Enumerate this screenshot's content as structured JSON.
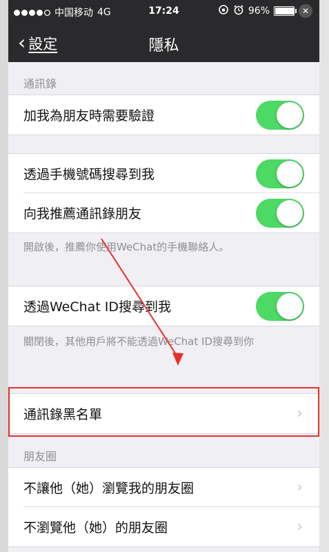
{
  "status_bar": {
    "carrier": "中国移动",
    "network": "4G",
    "time": "17:24",
    "battery_percent": "96%",
    "battery_level": 0.96
  },
  "nav": {
    "back_label": "設定",
    "title": "隱私"
  },
  "sections": {
    "contacts": {
      "header": "通訊錄",
      "verify_label": "加我為朋友時需要驗證"
    },
    "phone_search": {
      "search_by_phone_label": "透過手機號碼搜尋到我",
      "recommend_contacts_label": "向我推薦通訊錄朋友",
      "note": "開啟後，推薦你使用WeChat的手機聯絡人。"
    },
    "wechat_id": {
      "search_by_id_label": "透過WeChat ID搜尋到我",
      "note": "關閉後，其他用戶將不能透過WeChat ID搜尋到你"
    },
    "blacklist": {
      "label": "通訊錄黑名單"
    },
    "moments": {
      "header": "朋友圈",
      "hide_my_moments_label": "不讓他（她）瀏覽我的朋友圈",
      "hide_their_moments_label": "不瀏覽他（她）的朋友圈"
    }
  },
  "toggles": {
    "verify": true,
    "search_by_phone": true,
    "recommend_contacts": true,
    "search_by_id": true
  },
  "colors": {
    "toggle_on": "#4cd964",
    "nav_background": "#2a2a2c",
    "annotation_red": "#e8302b"
  }
}
